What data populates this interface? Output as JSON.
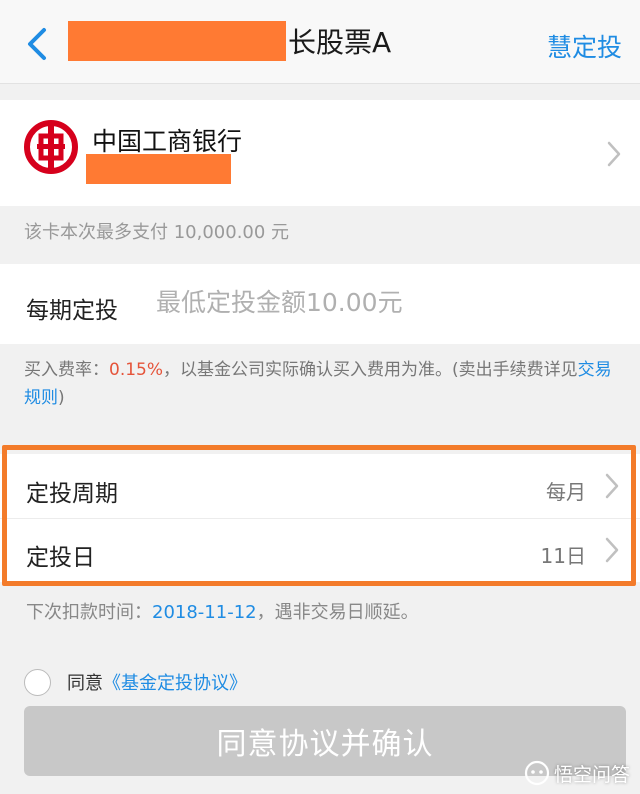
{
  "header": {
    "title_suffix": "长股票A",
    "right_action": "慧定投"
  },
  "bank": {
    "name": "中国工商银行",
    "logo_color": "#d6001c"
  },
  "limit_hint": "该卡本次最多支付 10,000.00 元",
  "amount": {
    "label": "每期定投",
    "placeholder": "最低定投金额10.00元",
    "value": ""
  },
  "fee": {
    "prefix": "买入费率：",
    "rate": "0.15%",
    "middle": "，以基金公司实际确认买入费用为准。(卖出手续费详见",
    "link": "交易规则",
    "suffix": ")"
  },
  "schedule": {
    "period_label": "定投周期",
    "period_value": "每月",
    "day_label": "定投日",
    "day_value": "11日"
  },
  "next_debit": {
    "prefix": "下次扣款时间：",
    "date": "2018-11-12",
    "suffix": "，遇非交易日顺延。"
  },
  "agreement": {
    "prefix": "同意",
    "link": "《基金定投协议》"
  },
  "confirm_button": "同意协议并确认",
  "watermark": "悟空问答",
  "colors": {
    "accent": "#1f8ce3",
    "highlight": "#f37b2a",
    "redaction": "#ff7a33",
    "fee_rate": "#e5543a"
  }
}
